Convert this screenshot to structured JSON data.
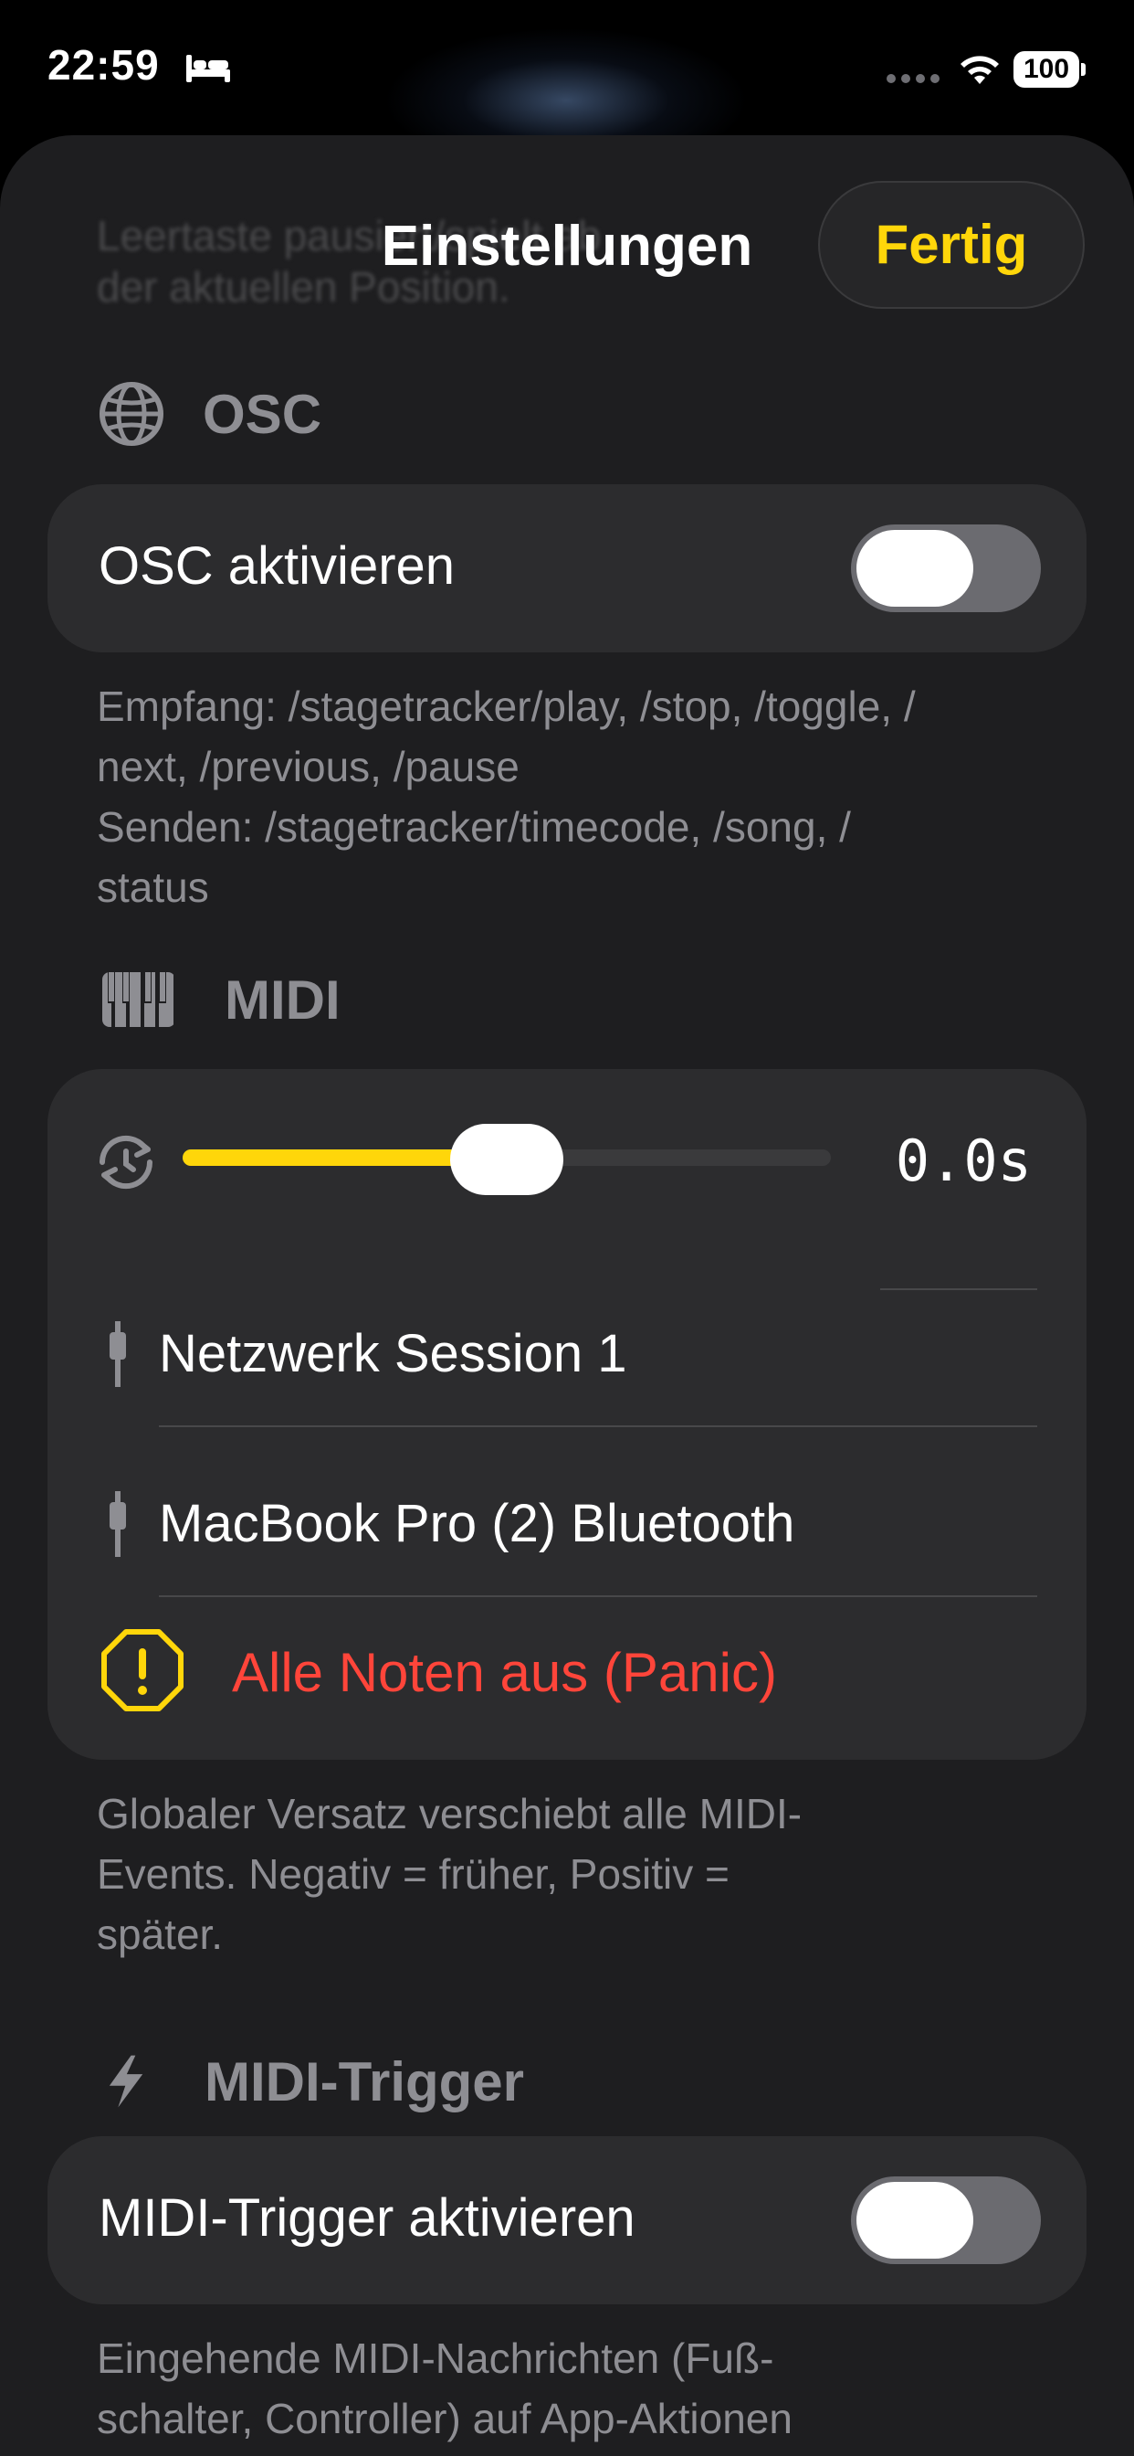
{
  "status_bar": {
    "time": "22:59",
    "battery": "100",
    "icons": [
      "bed-icon",
      "cellular-dots-icon",
      "wifi-icon",
      "battery-icon"
    ]
  },
  "sheet": {
    "background_text": "Leertaste pausiert/spielt ab\nder aktuellen Position.",
    "title": "Einstellungen",
    "done_label": "Fertig"
  },
  "colors": {
    "accent": "#ffd60a",
    "destructive": "#ff453a",
    "card": "#2c2c2e",
    "sheet": "#1e1e20",
    "secondary_text": "#8e8e93"
  },
  "osc": {
    "header": "OSC",
    "icon": "globe-icon",
    "toggle_label": "OSC aktivieren",
    "toggle_on": false,
    "footnote": "Empfang: /stagetracker/play, /stop, /toggle, /\nnext, /previous, /pause\nSenden: /stagetracker/timecode, /song, /\nstatus"
  },
  "midi": {
    "header": "MIDI",
    "icon": "piano-keys-icon",
    "offset_icon": "clock-arrows-icon",
    "offset_value": "0.0s",
    "offset_slider_fraction": 0.5,
    "devices": [
      {
        "name": "Netzwerk Session 1",
        "icon": "plug-icon"
      },
      {
        "name": "MacBook Pro (2) Bluetooth",
        "icon": "plug-icon"
      }
    ],
    "panic_label": "Alle Noten aus (Panic)",
    "panic_icon": "warning-octagon-icon",
    "footnote": "Globaler Versatz verschiebt alle MIDI-\nEvents. Negativ = früher, Positiv =\nspäter."
  },
  "midi_trigger": {
    "header": "MIDI-Trigger",
    "icon": "lightning-bolt-icon",
    "toggle_label": "MIDI-Trigger aktivieren",
    "toggle_on": false,
    "footnote": "Eingehende MIDI-Nachrichten (Fuß-\nschalter, Controller) auf App-Aktionen"
  }
}
